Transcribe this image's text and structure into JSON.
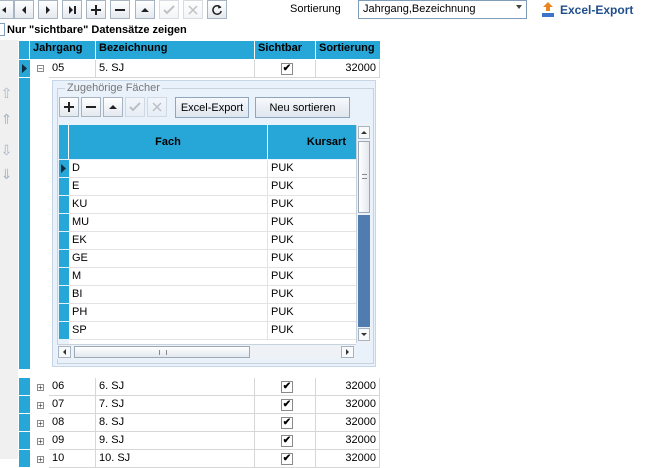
{
  "toolbar": {
    "buttons": [
      "first",
      "prev",
      "next",
      "last",
      "add",
      "remove",
      "up",
      "save",
      "cancel",
      "refresh"
    ],
    "sort_label": "Sortierung",
    "sort_value": "Jahrgang,Bezeichnung",
    "excel_export": "Excel-Export"
  },
  "filter": {
    "show_visible_label": "Nur \"sichtbare\" Datensätze zeigen"
  },
  "grid": {
    "columns": [
      "Jahrgang",
      "Bezeichnung",
      "Sichtbar",
      "Sortierung"
    ],
    "rows": [
      {
        "jahrgang": "05",
        "bezeichnung": "5. SJ",
        "sichtbar": "✔",
        "sortierung": "32000",
        "expanded": true
      },
      {
        "jahrgang": "06",
        "bezeichnung": "6. SJ",
        "sichtbar": "✔",
        "sortierung": "32000",
        "expanded": false
      },
      {
        "jahrgang": "07",
        "bezeichnung": "7. SJ",
        "sichtbar": "✔",
        "sortierung": "32000",
        "expanded": false
      },
      {
        "jahrgang": "08",
        "bezeichnung": "8. SJ",
        "sichtbar": "✔",
        "sortierung": "32000",
        "expanded": false
      },
      {
        "jahrgang": "09",
        "bezeichnung": "9. SJ",
        "sichtbar": "✔",
        "sortierung": "32000",
        "expanded": false
      },
      {
        "jahrgang": "10",
        "bezeichnung": "10. SJ",
        "sichtbar": "✔",
        "sortierung": "32000",
        "expanded": false
      }
    ]
  },
  "detail": {
    "group_title": "Zugehörige Fächer",
    "excel_export": "Excel-Export",
    "resort": "Neu sortieren",
    "columns": [
      "Fach",
      "Kursart"
    ],
    "rows": [
      {
        "fach": "D",
        "kursart": "PUK"
      },
      {
        "fach": "E",
        "kursart": "PUK"
      },
      {
        "fach": "KU",
        "kursart": "PUK"
      },
      {
        "fach": "MU",
        "kursart": "PUK"
      },
      {
        "fach": "EK",
        "kursart": "PUK"
      },
      {
        "fach": "GE",
        "kursart": "PUK"
      },
      {
        "fach": "M",
        "kursart": "PUK"
      },
      {
        "fach": "BI",
        "kursart": "PUK"
      },
      {
        "fach": "PH",
        "kursart": "PUK"
      },
      {
        "fach": "SP",
        "kursart": "PUK"
      }
    ]
  },
  "colors": {
    "header": "#27a6d8",
    "export_text": "#1f4e8c"
  }
}
